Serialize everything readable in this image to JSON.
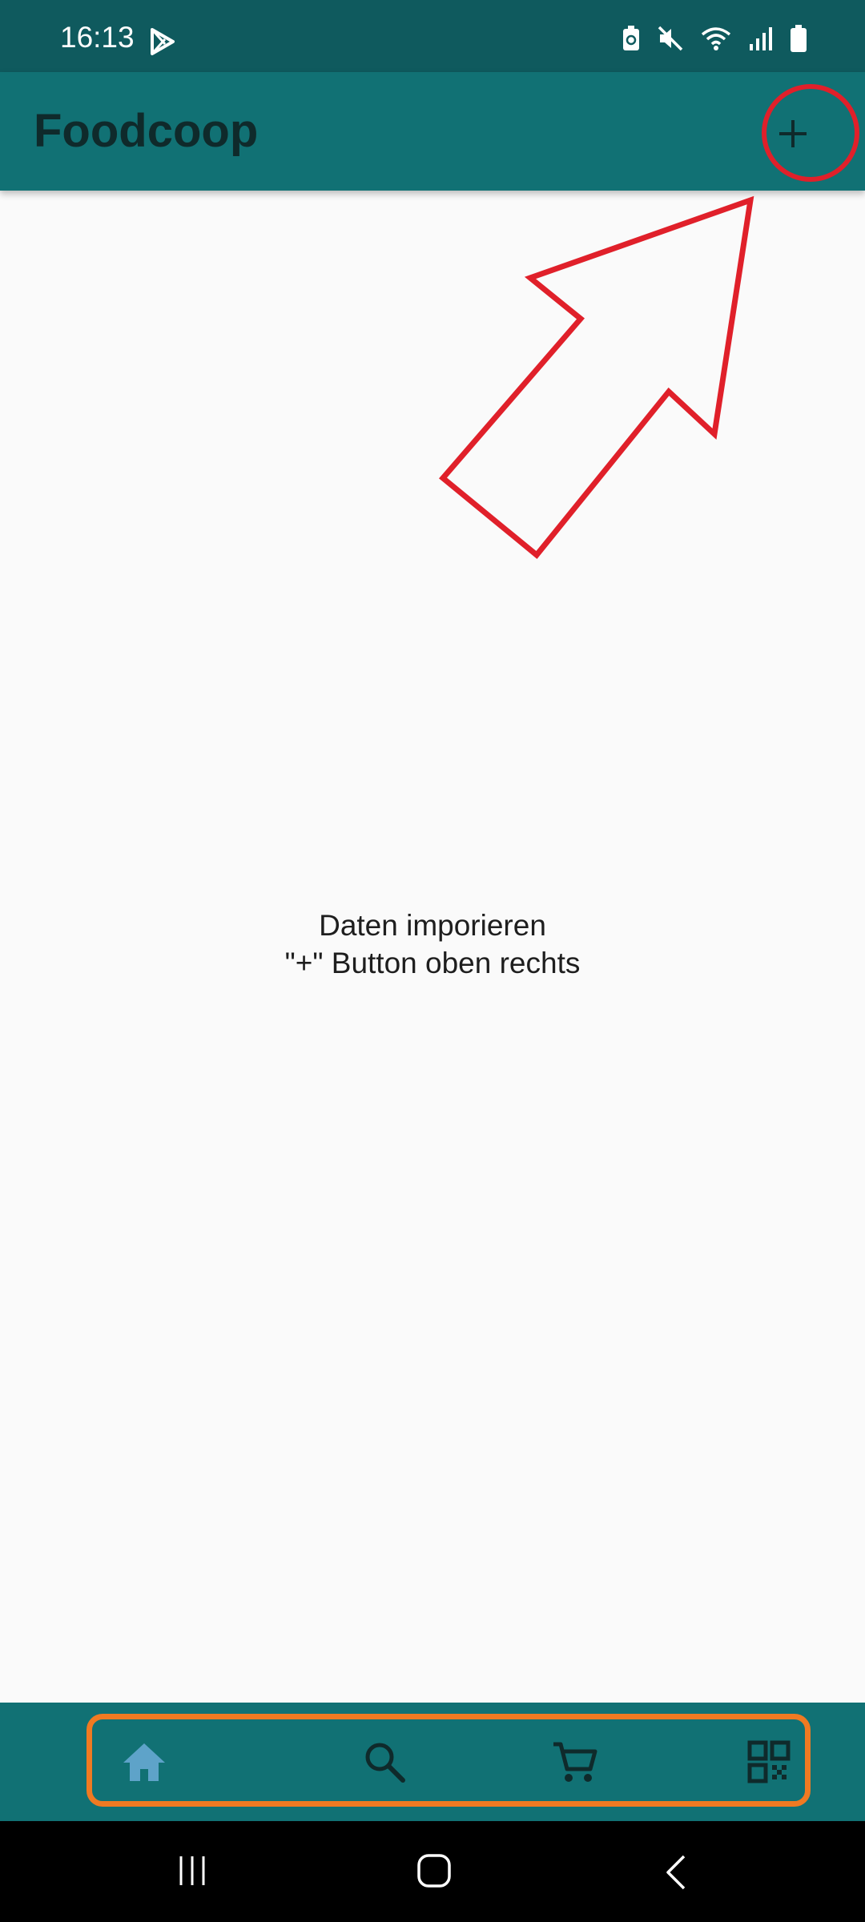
{
  "status_bar": {
    "time": "16:13",
    "icons": [
      "play-store-icon",
      "battery-saver-icon",
      "mute-icon",
      "wifi-icon",
      "signal-icon",
      "battery-icon"
    ]
  },
  "app_bar": {
    "title": "Foodcoop",
    "add_icon": "plus-icon"
  },
  "main": {
    "empty_line1": "Daten imporieren",
    "empty_line2": "\"+\" Button oben rechts"
  },
  "bottom_nav": {
    "items": [
      "home-icon",
      "search-icon",
      "cart-icon",
      "qr-code-icon"
    ],
    "active_index": 0
  },
  "system_nav": [
    "recent-apps-icon",
    "home-button-icon",
    "back-icon"
  ],
  "colors": {
    "status_bar": "#0f5a5e",
    "app_bar": "#117174",
    "background": "#fafafa",
    "annotation_red": "#e0202a",
    "annotation_orange": "#f07a22",
    "active_icon": "#5ea3c9"
  }
}
